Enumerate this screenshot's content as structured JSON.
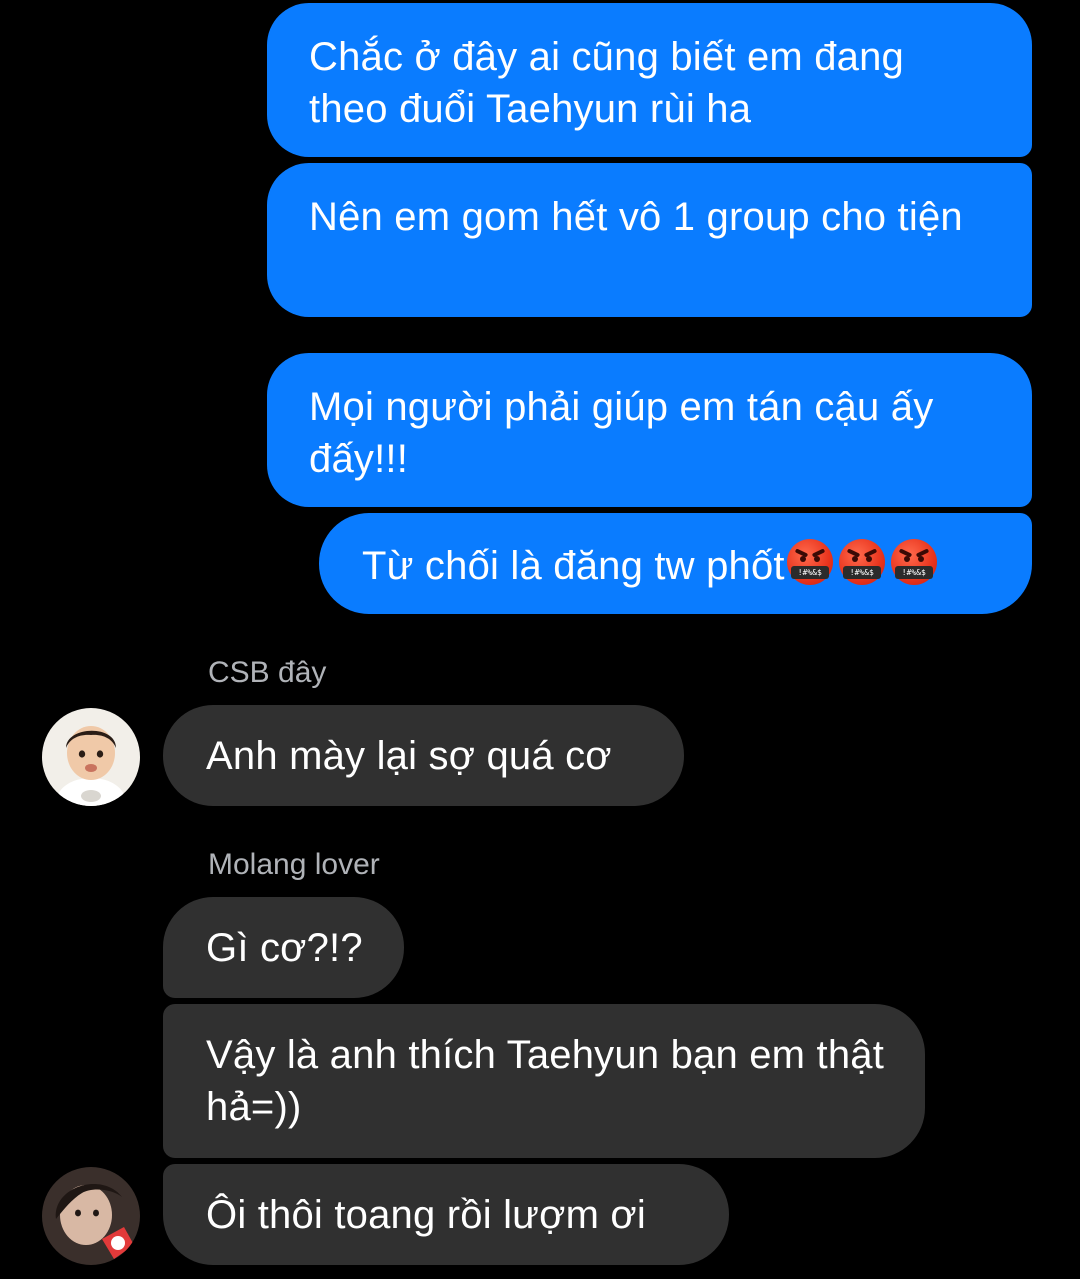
{
  "outgoing_messages": [
    "Chắc ở đây ai cũng biết em đang theo đuổi Taehyun rùi ha",
    "Nên em gom hết vô 1 group cho tiện",
    "Mọi người phải giúp em tán cậu ấy đấy!!!",
    "Từ chối là đăng tw phốt"
  ],
  "emoji": {
    "name": "face-with-symbols-on-mouth-icon",
    "count": 3,
    "symbol_text": "!#%&$"
  },
  "incoming_groups": [
    {
      "sender": "CSB đây",
      "messages": [
        "Anh mày lại sợ quá cơ"
      ]
    },
    {
      "sender": "Molang lover",
      "messages": [
        "Gì cơ?!?",
        "Vậy là anh thích Taehyun bạn em thật hả=))",
        "Ôi thôi toang rồi lượm ơi"
      ]
    }
  ],
  "colors": {
    "background": "#000000",
    "outgoing_bubble": "#0A7CFF",
    "incoming_bubble": "#303030",
    "sender_name": "#B0B3B8",
    "text": "#FFFFFF"
  }
}
